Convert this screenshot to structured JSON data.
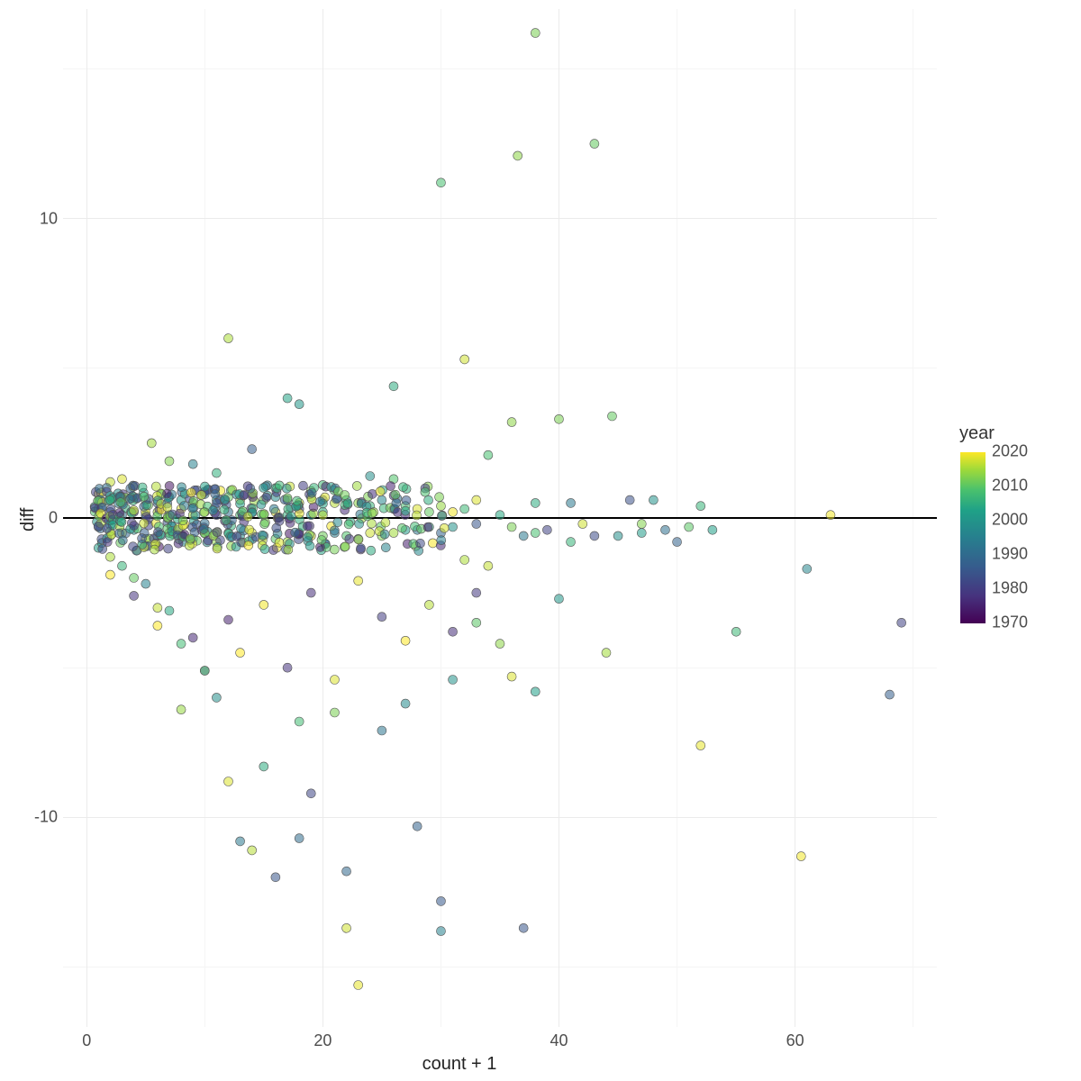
{
  "chart_data": {
    "type": "scatter",
    "xlabel": "count + 1",
    "ylabel": "diff",
    "title": "",
    "xlim": [
      -2,
      72
    ],
    "ylim": [
      -17,
      17
    ],
    "x_breaks": [
      0,
      20,
      40,
      60
    ],
    "y_breaks": [
      -10,
      0,
      10
    ],
    "hline_y": 0,
    "color_scale": {
      "name": "year",
      "type": "viridis",
      "breaks": [
        1970,
        1980,
        1990,
        2000,
        2010,
        2020
      ],
      "range": [
        1965,
        2022
      ]
    },
    "note": "Points estimated from image; dense cluster near y=0 for x in 1..30, tails and outliers as shown.",
    "series": [
      {
        "name": "observations",
        "points": [
          {
            "x": 38,
            "y": 16.2,
            "year": 2010
          },
          {
            "x": 43,
            "y": 12.5,
            "year": 2008
          },
          {
            "x": 36.5,
            "y": 12.1,
            "year": 2012
          },
          {
            "x": 30,
            "y": 11.2,
            "year": 2005
          },
          {
            "x": 12,
            "y": 6.0,
            "year": 2015
          },
          {
            "x": 32,
            "y": 5.3,
            "year": 2018
          },
          {
            "x": 26,
            "y": 4.4,
            "year": 2000
          },
          {
            "x": 17,
            "y": 4.0,
            "year": 1998
          },
          {
            "x": 18,
            "y": 3.8,
            "year": 1995
          },
          {
            "x": 40,
            "y": 3.3,
            "year": 2010
          },
          {
            "x": 36,
            "y": 3.2,
            "year": 2012
          },
          {
            "x": 44.5,
            "y": 3.4,
            "year": 2008
          },
          {
            "x": 34,
            "y": 2.1,
            "year": 2005
          },
          {
            "x": 14,
            "y": 2.3,
            "year": 1982
          },
          {
            "x": 5.5,
            "y": 2.5,
            "year": 2014
          },
          {
            "x": 7,
            "y": 1.9,
            "year": 2011
          },
          {
            "x": 9,
            "y": 1.8,
            "year": 1990
          },
          {
            "x": 11,
            "y": 1.5,
            "year": 2001
          },
          {
            "x": 3,
            "y": 1.3,
            "year": 2019
          },
          {
            "x": 2,
            "y": 1.2,
            "year": 2017
          },
          {
            "x": 24,
            "y": 1.4,
            "year": 1993
          },
          {
            "x": 26,
            "y": 1.3,
            "year": 2006
          },
          {
            "x": 20,
            "y": 1.1,
            "year": 2003
          },
          {
            "x": 16,
            "y": 1.0,
            "year": 1998
          },
          {
            "x": 19,
            "y": 0.9,
            "year": 2010
          },
          {
            "x": 33,
            "y": 0.6,
            "year": 2019
          },
          {
            "x": 38,
            "y": 0.5,
            "year": 2000
          },
          {
            "x": 41,
            "y": 0.5,
            "year": 1988
          },
          {
            "x": 46,
            "y": 0.6,
            "year": 1979
          },
          {
            "x": 48,
            "y": 0.6,
            "year": 1994
          },
          {
            "x": 52,
            "y": 0.4,
            "year": 2002
          },
          {
            "x": 63,
            "y": 0.1,
            "year": 2021
          },
          {
            "x": 69,
            "y": -3.5,
            "year": 1976
          },
          {
            "x": 68,
            "y": -5.9,
            "year": 1982
          },
          {
            "x": 61,
            "y": -1.7,
            "year": 1991
          },
          {
            "x": 60.5,
            "y": -11.3,
            "year": 2021
          },
          {
            "x": 55,
            "y": -3.8,
            "year": 2003
          },
          {
            "x": 52,
            "y": -7.6,
            "year": 2020
          },
          {
            "x": 50,
            "y": -0.8,
            "year": 1983
          },
          {
            "x": 44,
            "y": -4.5,
            "year": 2014
          },
          {
            "x": 47,
            "y": -0.5,
            "year": 1996
          },
          {
            "x": 40,
            "y": -2.7,
            "year": 1995
          },
          {
            "x": 43,
            "y": -0.6,
            "year": 1978
          },
          {
            "x": 38,
            "y": -5.8,
            "year": 1997
          },
          {
            "x": 36,
            "y": -5.3,
            "year": 2019
          },
          {
            "x": 37,
            "y": -13.7,
            "year": 1980
          },
          {
            "x": 35,
            "y": -4.2,
            "year": 2012
          },
          {
            "x": 33,
            "y": -3.5,
            "year": 2007
          },
          {
            "x": 31,
            "y": -5.4,
            "year": 1994
          },
          {
            "x": 30,
            "y": -13.8,
            "year": 1990
          },
          {
            "x": 30,
            "y": -12.8,
            "year": 1981
          },
          {
            "x": 28,
            "y": -10.3,
            "year": 1983
          },
          {
            "x": 27,
            "y": -6.2,
            "year": 1992
          },
          {
            "x": 25,
            "y": -7.1,
            "year": 1987
          },
          {
            "x": 23,
            "y": -15.6,
            "year": 2020
          },
          {
            "x": 22,
            "y": -13.7,
            "year": 2018
          },
          {
            "x": 22,
            "y": -11.8,
            "year": 1984
          },
          {
            "x": 21,
            "y": -6.5,
            "year": 2010
          },
          {
            "x": 19,
            "y": -9.2,
            "year": 1977
          },
          {
            "x": 18,
            "y": -6.8,
            "year": 2004
          },
          {
            "x": 18,
            "y": -10.7,
            "year": 1985
          },
          {
            "x": 16,
            "y": -12.0,
            "year": 1980
          },
          {
            "x": 14,
            "y": -11.1,
            "year": 2016
          },
          {
            "x": 13,
            "y": -10.8,
            "year": 1988
          },
          {
            "x": 12,
            "y": -8.8,
            "year": 2019
          },
          {
            "x": 15,
            "y": -8.3,
            "year": 2000
          },
          {
            "x": 11,
            "y": -6.0,
            "year": 1993
          },
          {
            "x": 10,
            "y": -5.1,
            "year": 1975
          },
          {
            "x": 10,
            "y": -5.1,
            "year": 2006
          },
          {
            "x": 8,
            "y": -6.4,
            "year": 2013
          },
          {
            "x": 8,
            "y": -4.2,
            "year": 2004
          },
          {
            "x": 7,
            "y": -3.1,
            "year": 1999
          },
          {
            "x": 6,
            "y": -3.0,
            "year": 2017
          },
          {
            "x": 5,
            "y": -2.2,
            "year": 1990
          },
          {
            "x": 4,
            "y": -2.0,
            "year": 2008
          },
          {
            "x": 3,
            "y": -1.6,
            "year": 2002
          },
          {
            "x": 2,
            "y": -1.3,
            "year": 2015
          },
          {
            "x": 1,
            "y": -1.0,
            "year": 1997
          },
          {
            "x": 1,
            "y": 0.8,
            "year": 2021
          },
          {
            "x": 1,
            "y": 0.3,
            "year": 2004
          },
          {
            "x": 1,
            "y": -0.3,
            "year": 1986
          },
          {
            "x": 2,
            "y": 0.6,
            "year": 1994
          },
          {
            "x": 2,
            "y": -0.6,
            "year": 2009
          },
          {
            "x": 2,
            "y": 0.2,
            "year": 1979
          },
          {
            "x": 3,
            "y": 0.5,
            "year": 2000
          },
          {
            "x": 3,
            "y": -0.5,
            "year": 2017
          },
          {
            "x": 3,
            "y": 0.1,
            "year": 1985
          },
          {
            "x": 4,
            "y": 0.7,
            "year": 2013
          },
          {
            "x": 4,
            "y": -0.4,
            "year": 1992
          },
          {
            "x": 4,
            "y": 0.2,
            "year": 1975
          },
          {
            "x": 5,
            "y": 0.6,
            "year": 2007
          },
          {
            "x": 5,
            "y": -0.7,
            "year": 2020
          },
          {
            "x": 5,
            "y": 0.1,
            "year": 1998
          },
          {
            "x": 6,
            "y": 0.5,
            "year": 1983
          },
          {
            "x": 6,
            "y": -0.6,
            "year": 2003
          },
          {
            "x": 6,
            "y": 0.2,
            "year": 2016
          },
          {
            "x": 7,
            "y": 0.7,
            "year": 1989
          },
          {
            "x": 7,
            "y": -0.5,
            "year": 2011
          },
          {
            "x": 7,
            "y": 0.1,
            "year": 2002
          },
          {
            "x": 8,
            "y": 0.6,
            "year": 1996
          },
          {
            "x": 8,
            "y": -0.6,
            "year": 1980
          },
          {
            "x": 8,
            "y": 0.3,
            "year": 2019
          },
          {
            "x": 9,
            "y": 0.5,
            "year": 2006
          },
          {
            "x": 9,
            "y": -0.7,
            "year": 1991
          },
          {
            "x": 9,
            "y": 0.1,
            "year": 2014
          },
          {
            "x": 10,
            "y": 0.8,
            "year": 1987
          },
          {
            "x": 10,
            "y": -0.5,
            "year": 2001
          },
          {
            "x": 10,
            "y": 0.2,
            "year": 2021
          },
          {
            "x": 11,
            "y": 0.6,
            "year": 1994
          },
          {
            "x": 11,
            "y": -0.8,
            "year": 2012
          },
          {
            "x": 11,
            "y": 0.1,
            "year": 1978
          },
          {
            "x": 12,
            "y": 0.7,
            "year": 2008
          },
          {
            "x": 12,
            "y": -0.5,
            "year": 1999
          },
          {
            "x": 12,
            "y": 0.2,
            "year": 1986
          },
          {
            "x": 13,
            "y": 0.6,
            "year": 2015
          },
          {
            "x": 13,
            "y": -0.6,
            "year": 1993
          },
          {
            "x": 13,
            "y": 0.1,
            "year": 2005
          },
          {
            "x": 14,
            "y": 0.8,
            "year": 1981
          },
          {
            "x": 14,
            "y": -0.5,
            "year": 2018
          },
          {
            "x": 14,
            "y": 0.2,
            "year": 1997
          },
          {
            "x": 15,
            "y": 0.6,
            "year": 2010
          },
          {
            "x": 15,
            "y": -0.6,
            "year": 1984
          },
          {
            "x": 15,
            "y": 0.1,
            "year": 2003
          },
          {
            "x": 16,
            "y": 0.7,
            "year": 1992
          },
          {
            "x": 16,
            "y": -0.7,
            "year": 2007
          },
          {
            "x": 16,
            "y": 0.2,
            "year": 2020
          },
          {
            "x": 17,
            "y": 0.6,
            "year": 1988
          },
          {
            "x": 17,
            "y": -0.8,
            "year": 2013
          },
          {
            "x": 17,
            "y": 0.1,
            "year": 2001
          },
          {
            "x": 18,
            "y": 0.5,
            "year": 2017
          },
          {
            "x": 18,
            "y": -0.5,
            "year": 1990
          },
          {
            "x": 18,
            "y": 0.3,
            "year": 1977
          },
          {
            "x": 19,
            "y": 0.7,
            "year": 2004
          },
          {
            "x": 19,
            "y": -0.6,
            "year": 2019
          },
          {
            "x": 19,
            "y": 0.1,
            "year": 1995
          },
          {
            "x": 20,
            "y": 0.6,
            "year": 1982
          },
          {
            "x": 20,
            "y": -0.6,
            "year": 2009
          },
          {
            "x": 20,
            "y": 0.2,
            "year": 2000
          },
          {
            "x": 21,
            "y": 0.5,
            "year": 2016
          },
          {
            "x": 21,
            "y": -0.5,
            "year": 1989
          },
          {
            "x": 22,
            "y": 0.6,
            "year": 1998
          },
          {
            "x": 22,
            "y": -0.6,
            "year": 2006
          },
          {
            "x": 23,
            "y": 0.5,
            "year": 2012
          },
          {
            "x": 23,
            "y": -0.7,
            "year": 1985
          },
          {
            "x": 24,
            "y": 0.4,
            "year": 2002
          },
          {
            "x": 24,
            "y": -0.5,
            "year": 2018
          },
          {
            "x": 25,
            "y": 0.6,
            "year": 1991
          },
          {
            "x": 25,
            "y": -0.6,
            "year": 2011
          },
          {
            "x": 26,
            "y": 0.3,
            "year": 1979
          },
          {
            "x": 26,
            "y": -0.5,
            "year": 2014
          },
          {
            "x": 27,
            "y": 0.4,
            "year": 2005
          },
          {
            "x": 27,
            "y": -0.4,
            "year": 1996
          },
          {
            "x": 28,
            "y": 0.3,
            "year": 2019
          },
          {
            "x": 28,
            "y": -0.4,
            "year": 1987
          },
          {
            "x": 29,
            "y": 0.2,
            "year": 2008
          },
          {
            "x": 29,
            "y": -0.3,
            "year": 2000
          },
          {
            "x": 30,
            "y": 0.4,
            "year": 2013
          },
          {
            "x": 30,
            "y": -0.5,
            "year": 1983
          },
          {
            "x": 31,
            "y": 0.2,
            "year": 2021
          },
          {
            "x": 31,
            "y": -0.3,
            "year": 1994
          },
          {
            "x": 32,
            "y": 0.3,
            "year": 2003
          },
          {
            "x": 32,
            "y": -1.4,
            "year": 2015
          },
          {
            "x": 33,
            "y": -0.2,
            "year": 1980
          },
          {
            "x": 34,
            "y": -1.6,
            "year": 2017
          },
          {
            "x": 35,
            "y": 0.1,
            "year": 1999
          },
          {
            "x": 36,
            "y": -0.3,
            "year": 2010
          },
          {
            "x": 37,
            "y": -0.6,
            "year": 1988
          },
          {
            "x": 38,
            "y": -0.5,
            "year": 2005
          },
          {
            "x": 39,
            "y": -0.4,
            "year": 1976
          },
          {
            "x": 41,
            "y": -0.8,
            "year": 2002
          },
          {
            "x": 42,
            "y": -0.2,
            "year": 2018
          },
          {
            "x": 45,
            "y": -0.6,
            "year": 1993
          },
          {
            "x": 47,
            "y": -0.2,
            "year": 2011
          },
          {
            "x": 49,
            "y": -0.4,
            "year": 1986
          },
          {
            "x": 51,
            "y": -0.3,
            "year": 2007
          },
          {
            "x": 53,
            "y": -0.4,
            "year": 1997
          },
          {
            "x": 2,
            "y": -1.9,
            "year": 2022
          },
          {
            "x": 4,
            "y": -2.6,
            "year": 1973
          },
          {
            "x": 6,
            "y": -3.6,
            "year": 2022
          },
          {
            "x": 9,
            "y": -4.0,
            "year": 1971
          },
          {
            "x": 13,
            "y": -4.5,
            "year": 2022
          },
          {
            "x": 17,
            "y": -5.0,
            "year": 1973
          },
          {
            "x": 21,
            "y": -5.4,
            "year": 2019
          },
          {
            "x": 25,
            "y": -3.3,
            "year": 1975
          },
          {
            "x": 29,
            "y": -2.9,
            "year": 2016
          },
          {
            "x": 33,
            "y": -2.5,
            "year": 1974
          },
          {
            "x": 23,
            "y": -2.1,
            "year": 2020
          },
          {
            "x": 19,
            "y": -2.5,
            "year": 1972
          },
          {
            "x": 15,
            "y": -2.9,
            "year": 2021
          },
          {
            "x": 12,
            "y": -3.4,
            "year": 1970
          },
          {
            "x": 27,
            "y": -4.1,
            "year": 2022
          },
          {
            "x": 31,
            "y": -3.8,
            "year": 1972
          }
        ]
      }
    ]
  },
  "axis": {
    "x_ticks": [
      "0",
      "20",
      "40",
      "60"
    ],
    "y_ticks": [
      "-10",
      "0",
      "10"
    ],
    "x_title": "count + 1",
    "y_title": "diff"
  },
  "legend": {
    "title": "year",
    "ticks": [
      "2020",
      "2010",
      "2000",
      "1990",
      "1980",
      "1970"
    ]
  }
}
